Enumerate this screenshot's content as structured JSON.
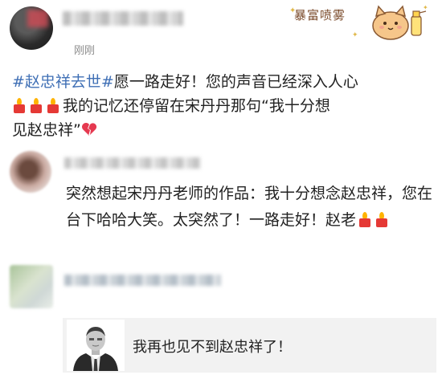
{
  "post": {
    "time": "刚刚",
    "topic": "#赵忠祥去世#",
    "line1_rest": "愿一路走好！您的声音已经深入人心",
    "line2": "我的记忆还停留在宋丹丹那句“我十分想",
    "line3": "见赵忠祥”"
  },
  "sticker": {
    "text": "暴富喷雾"
  },
  "comments": [
    {
      "text": "突然想起宋丹丹老师的作品：我十分想念赵忠祥，您在台下哈哈大笑。太突然了！一路走好！赵老"
    },
    {
      "quote_text": "我再也见不到赵忠祥了！"
    }
  ],
  "icons": {
    "candle": "candle-emoji",
    "broken_heart": "broken-heart-emoji",
    "cat": "cat-sticker"
  },
  "colors": {
    "topic": "#3f6fb5",
    "card_bg": "#f2f2f2",
    "candle": "#e53935",
    "flame": "#ffb300"
  }
}
